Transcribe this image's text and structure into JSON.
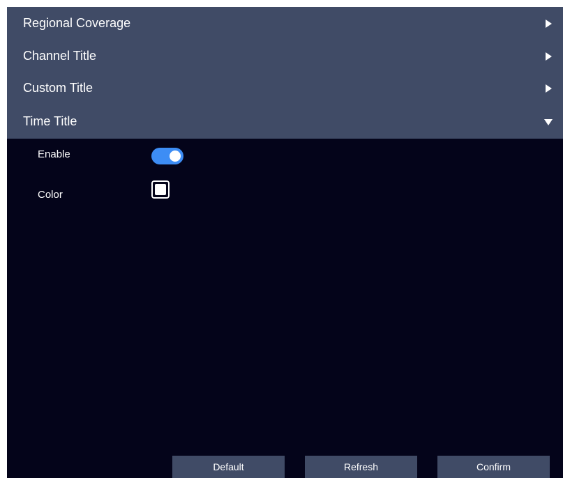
{
  "accordion": {
    "sections": [
      {
        "label": "Regional Coverage",
        "expanded": false,
        "icon": "chevron-right-icon"
      },
      {
        "label": "Channel Title",
        "expanded": false,
        "icon": "chevron-right-icon"
      },
      {
        "label": "Custom Title",
        "expanded": false,
        "icon": "chevron-right-icon"
      },
      {
        "label": "Time Title",
        "expanded": true,
        "icon": "chevron-down-icon"
      }
    ]
  },
  "time_title": {
    "enable_label": "Enable",
    "enable_value": true,
    "color_label": "Color",
    "color_value": "#ffffff"
  },
  "footer": {
    "default_label": "Default",
    "refresh_label": "Refresh",
    "confirm_label": "Confirm"
  },
  "colors": {
    "header_bg": "#404b66",
    "panel_bg": "#04041a",
    "toggle_on": "#3d8df5"
  }
}
